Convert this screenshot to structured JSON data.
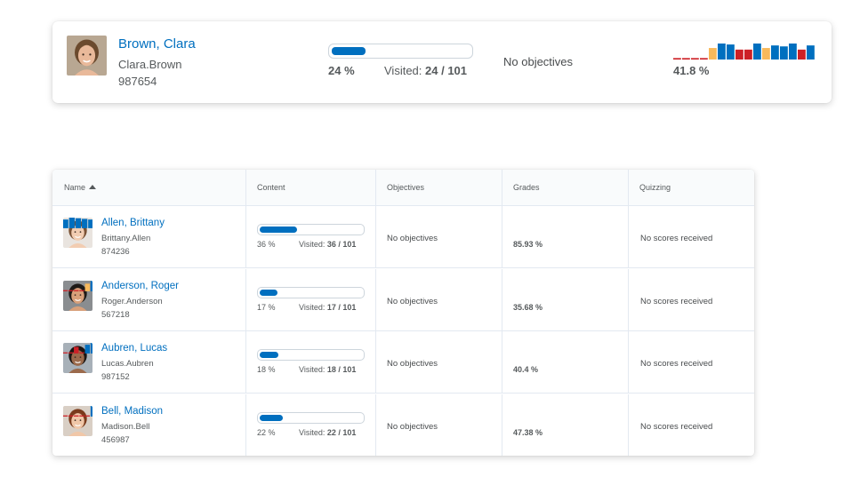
{
  "summary": {
    "name": "Brown, Clara",
    "username": "Clara.Brown",
    "org_id": "987654",
    "content_progress": 0.24,
    "content_pct": "24 %",
    "visited_label": "Visited:",
    "visited_value": "24 / 101",
    "objectives": "No objectives",
    "grade_pct": "41.8 %",
    "grade_bars": [
      "red-low",
      "red-low",
      "red-low",
      "red-low",
      "orange",
      "blue",
      "blue",
      "red",
      "red",
      "blue",
      "orange",
      "blue",
      "blue",
      "blue",
      "red",
      "blue"
    ],
    "avatar": {
      "skin": "#e9b99a",
      "hair": "#6b4a2e",
      "bg": "#b8a792"
    }
  },
  "table": {
    "headers": {
      "name": "Name",
      "content": "Content",
      "objectives": "Objectives",
      "grades": "Grades",
      "quizzing": "Quizzing"
    },
    "rows": [
      {
        "name": "Allen, Brittany",
        "username": "Brittany.Allen",
        "org_id": "874236",
        "content_progress": 0.36,
        "content_pct": "36 %",
        "visited_label": "Visited:",
        "visited_value": "36 / 101",
        "objectives": "No objectives",
        "grade_pct": "85.93 %",
        "grade_bars": [
          "blue",
          "blue",
          "blue",
          "blue",
          "blue",
          "orange",
          "blue",
          "blue",
          "blue",
          "blue",
          "blue",
          "blue",
          "blue",
          "blue"
        ],
        "quizzing": "No scores received",
        "avatar": {
          "skin": "#f2cdb2",
          "hair": "#7a5235",
          "bg": "#e9e4df"
        }
      },
      {
        "name": "Anderson, Roger",
        "username": "Roger.Anderson",
        "org_id": "567218",
        "content_progress": 0.17,
        "content_pct": "17 %",
        "visited_label": "Visited:",
        "visited_value": "17 / 101",
        "objectives": "No objectives",
        "grade_pct": "35.68 %",
        "grade_bars": [
          "red-low",
          "red-low",
          "red-low",
          "red-low",
          "orange",
          "blue",
          "blue",
          "orange",
          "blue",
          "blue",
          "blue",
          "blue",
          "blue",
          "orange",
          "blue",
          "orange"
        ],
        "quizzing": "No scores received",
        "avatar": {
          "skin": "#d8a07a",
          "hair": "#1e1a17",
          "bg": "#8a8d90"
        }
      },
      {
        "name": "Aubren, Lucas",
        "username": "Lucas.Aubren",
        "org_id": "987152",
        "content_progress": 0.18,
        "content_pct": "18 %",
        "visited_label": "Visited:",
        "visited_value": "18 / 101",
        "objectives": "No objectives",
        "grade_pct": "40.4 %",
        "grade_bars": [
          "red-low",
          "red-low",
          "red",
          "red-low",
          "blue",
          "blue",
          "blue",
          "blue",
          "orange",
          "blue",
          "orange",
          "blue",
          "blue",
          "blue",
          "orange",
          "blue"
        ],
        "quizzing": "No scores received",
        "avatar": {
          "skin": "#9b6a4c",
          "hair": "#1b1512",
          "bg": "#a7b0b8"
        }
      },
      {
        "name": "Bell, Madison",
        "username": "Madison.Bell",
        "org_id": "456987",
        "content_progress": 0.22,
        "content_pct": "22 %",
        "visited_label": "Visited:",
        "visited_value": "22 / 101",
        "objectives": "No objectives",
        "grade_pct": "47.38 %",
        "grade_bars": [
          "red-low",
          "red-low",
          "red-low",
          "red-low",
          "red-low",
          "blue",
          "red",
          "orange",
          "blue",
          "blue",
          "blue",
          "blue",
          "blue",
          "blue",
          "orange",
          "blue"
        ],
        "quizzing": "No scores received",
        "avatar": {
          "skin": "#f0c7a8",
          "hair": "#7a3b1c",
          "bg": "#d9cfc5"
        }
      }
    ]
  }
}
